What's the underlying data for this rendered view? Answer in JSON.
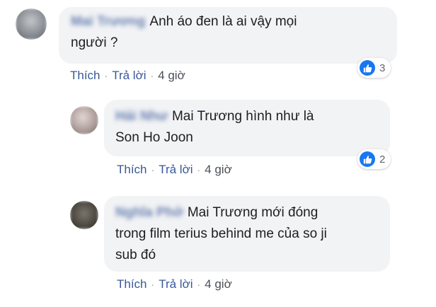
{
  "comments": [
    {
      "author": "Mai Trương",
      "text_line1": "Anh áo đen là ai vậy mọi",
      "text_line2": "người ?",
      "like_label": "Thích",
      "reply_label": "Trả lời",
      "time": "4 giờ",
      "reaction_count": "3",
      "reaction_icon": "like-icon",
      "avatar_color": "#8a8f96"
    },
    {
      "author": "Hải Như",
      "text_line1": "Mai Trương hình như là",
      "text_line2": "Son Ho Joon",
      "like_label": "Thích",
      "reply_label": "Trả lời",
      "time": "4 giờ",
      "reaction_count": "2",
      "reaction_icon": "like-icon",
      "avatar_color": "#b9a9a6"
    },
    {
      "author": "Nghĩa Phở",
      "text_line1": "Mai Trương mới đóng",
      "text_line2": "trong film terius behind me của so ji",
      "text_line3": "sub đó",
      "like_label": "Thích",
      "reply_label": "Trả lời",
      "time": "4 giờ",
      "avatar_color": "#4f4a42"
    }
  ],
  "colors": {
    "link": "#385898",
    "bubble": "#f2f3f5",
    "like_badge": "#1877f2"
  }
}
